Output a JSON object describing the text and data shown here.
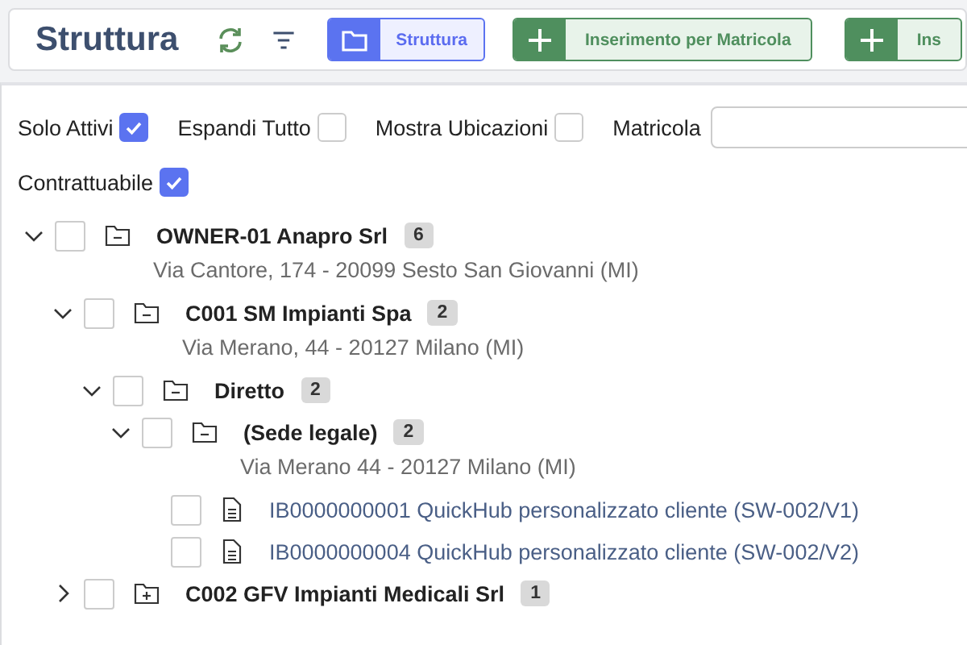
{
  "header": {
    "title": "Struttura",
    "view_button": {
      "label": "Struttura",
      "selected": true
    },
    "add_buttons": [
      {
        "label": "Inserimento per Matricola"
      },
      {
        "label": "Ins"
      }
    ]
  },
  "filters": [
    {
      "label": "Solo Attivi",
      "checked": true
    },
    {
      "label": "Espandi Tutto",
      "checked": false
    },
    {
      "label": "Mostra Ubicazioni",
      "checked": false
    },
    {
      "label": "Contrattuabile",
      "checked": true
    }
  ],
  "search": {
    "label": "Matricola"
  },
  "tree": [
    {
      "kind": "folder",
      "label": "OWNER-01 Anapro Srl",
      "count": "6",
      "address": "Via Cantore, 174 - 20099 Sesto San Giovanni (MI)",
      "expanded": true,
      "checked": false,
      "children": [
        {
          "kind": "folder",
          "label": "C001 SM Impianti Spa",
          "count": "2",
          "address": "Via Merano, 44 - 20127 Milano (MI)",
          "expanded": true,
          "checked": false,
          "children": [
            {
              "kind": "folder",
              "label": "Diretto",
              "count": "2",
              "expanded": true,
              "checked": false,
              "children": [
                {
                  "kind": "folder",
                  "label": "(Sede legale)",
                  "count": "2",
                  "address": "Via Merano 44 - 20127 Milano (MI)",
                  "expanded": true,
                  "checked": false,
                  "children": [
                    {
                      "kind": "file",
                      "label": "IB0000000001 QuickHub personalizzato cliente (SW-002/V1)",
                      "checked": false
                    },
                    {
                      "kind": "file",
                      "label": "IB0000000004 QuickHub personalizzato cliente (SW-002/V2)",
                      "checked": false
                    }
                  ]
                }
              ]
            }
          ]
        },
        {
          "kind": "folder",
          "label": "C002 GFV Impianti Medicali Srl",
          "count": "1",
          "expanded": false,
          "checked": false
        }
      ]
    }
  ]
}
